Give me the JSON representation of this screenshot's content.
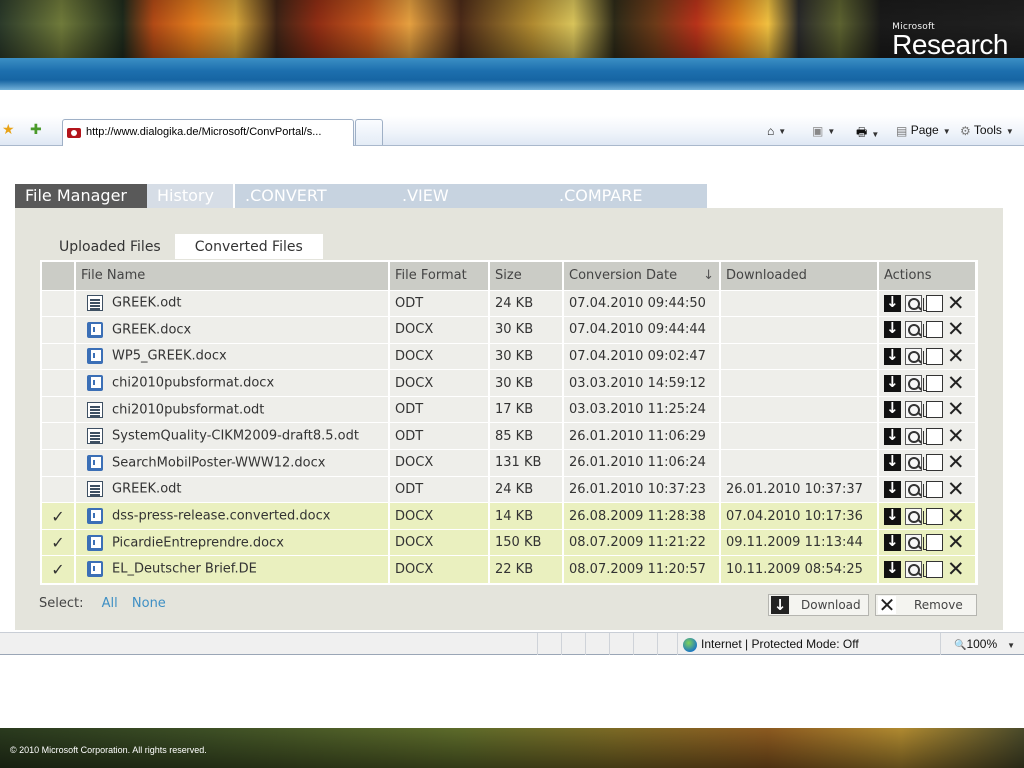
{
  "slide": {
    "brand_small": "Microsoft",
    "brand_big": "Research",
    "footer_copyright": "© 2010 Microsoft Corporation. All rights reserved."
  },
  "browser": {
    "tab_url": "http://www.dialogika.de/Microsoft/ConvPortal/s...",
    "commands": {
      "page": "Page",
      "tools": "Tools"
    },
    "status": {
      "zone": "Internet | Protected Mode: Off",
      "zoom": "100%"
    }
  },
  "portal": {
    "main_tabs": [
      {
        "label": "File Manager",
        "active": true
      },
      {
        "label": "History"
      },
      {
        "label": ".CONVERT"
      },
      {
        "label": ".VIEW"
      },
      {
        "label": ".COMPARE"
      }
    ],
    "sub_tabs": [
      {
        "label": "Uploaded Files"
      },
      {
        "label": "Converted Files",
        "active": true
      }
    ],
    "columns": {
      "file_name": "File Name",
      "file_format": "File Format",
      "size": "Size",
      "conversion_date": "Conversion Date",
      "downloaded": "Downloaded",
      "actions": "Actions"
    },
    "rows": [
      {
        "checked": false,
        "icon": "odt",
        "name": "GREEK.odt",
        "format": "ODT",
        "size": "24 KB",
        "date": "07.04.2010 09:44:50",
        "downloaded": ""
      },
      {
        "checked": false,
        "icon": "docx",
        "name": "GREEK.docx",
        "format": "DOCX",
        "size": "30 KB",
        "date": "07.04.2010 09:44:44",
        "downloaded": ""
      },
      {
        "checked": false,
        "icon": "docx",
        "name": "WP5_GREEK.docx",
        "format": "DOCX",
        "size": "30 KB",
        "date": "07.04.2010 09:02:47",
        "downloaded": ""
      },
      {
        "checked": false,
        "icon": "docx",
        "name": "chi2010pubsformat.docx",
        "format": "DOCX",
        "size": "30 KB",
        "date": "03.03.2010 14:59:12",
        "downloaded": ""
      },
      {
        "checked": false,
        "icon": "odt",
        "name": "chi2010pubsformat.odt",
        "format": "ODT",
        "size": "17 KB",
        "date": "03.03.2010 11:25:24",
        "downloaded": ""
      },
      {
        "checked": false,
        "icon": "odt",
        "name": "SystemQuality-CIKM2009-draft8.5.odt",
        "format": "ODT",
        "size": "85 KB",
        "date": "26.01.2010 11:06:29",
        "downloaded": ""
      },
      {
        "checked": false,
        "icon": "docx",
        "name": "SearchMobilPoster-WWW12.docx",
        "format": "DOCX",
        "size": "131 KB",
        "date": "26.01.2010 11:06:24",
        "downloaded": ""
      },
      {
        "checked": false,
        "icon": "odt",
        "name": "GREEK.odt",
        "format": "ODT",
        "size": "24 KB",
        "date": "26.01.2010 10:37:23",
        "downloaded": "26.01.2010 10:37:37"
      },
      {
        "checked": true,
        "icon": "docx",
        "name": "dss-press-release.converted.docx",
        "format": "DOCX",
        "size": "14 KB",
        "date": "26.08.2009 11:28:38",
        "downloaded": "07.04.2010 10:17:36"
      },
      {
        "checked": true,
        "icon": "docx",
        "name": "PicardieEntreprendre.docx",
        "format": "DOCX",
        "size": "150 KB",
        "date": "08.07.2009 11:21:22",
        "downloaded": "09.11.2009 11:13:44"
      },
      {
        "checked": true,
        "icon": "docx",
        "name": "EL_Deutscher Brief.DE",
        "format": "DOCX",
        "size": "22 KB",
        "date": "08.07.2009 11:20:57",
        "downloaded": "10.11.2009 08:54:25"
      }
    ],
    "select": {
      "label": "Select:",
      "all": "All",
      "none": "None"
    },
    "buttons": {
      "download": "Download",
      "remove": "Remove"
    }
  }
}
